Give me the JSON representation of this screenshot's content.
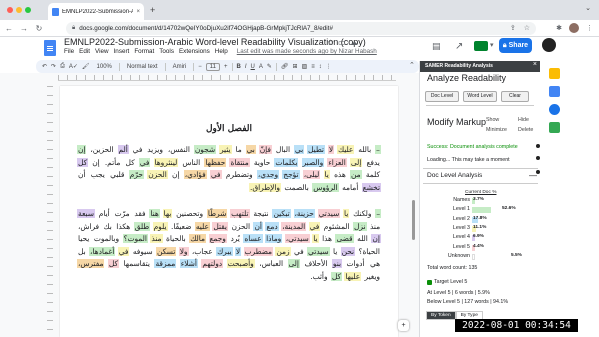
{
  "browser": {
    "tab_title": "EMNLP2022-Submission-Arabi",
    "url": "docs.google.com/document/d/14702wQeIY0oDjuXu2if74OGHjapB-GrMpkjTJcRlA7_8/edit#",
    "tab_close": "×",
    "new_tab": "+",
    "menu": "⌄"
  },
  "doc": {
    "title": "EMNLP2022-Submission-Arabic Word-level Readability Visualization (copy)",
    "menu": [
      "File",
      "Edit",
      "View",
      "Insert",
      "Format",
      "Tools",
      "Extensions",
      "Help"
    ],
    "last_edit": "Last edit was made seconds ago by Nizar Habash",
    "share": "Share"
  },
  "toolbar": {
    "zoom": "100%",
    "style": "Normal text",
    "font": "Amiri",
    "size": "11",
    "plus": "+",
    "minus": "−"
  },
  "page": {
    "chapter": "الفصل الأول",
    "p1": [
      {
        "t": "– بالله عليك لا تطيل بي البال فإنّ بي ما يثير شجون النفس، ويزيد في ألم الحزين، إن يدفع إلى العزاء والصبر بكلمات حاوية منتقاة حفظها الناس لينثروها في كل مأتم. إن كل كلمة من هذه يا ليلى، تؤجج وجدي، وتضطرم في فؤادي، إن الحزن حرّم قلبي يجب أن تخشع أمامه الرؤوس بالصمت والإطراق.",
        "c": ""
      }
    ],
    "p2": [
      {
        "t": "– ولكنك يا سيدتي حزينة، تبكين نتيجة تلتهب شرطًا وتحصنين بها هنا فقد مرّت أيام سبعة منذ نزل المشئوم في المدينة، دمع أن الحزن يقتل عليه ضعيفًا. يلوم طلق هكذا بك فراش، إن الله قضى هذا يا سيدتي، وماذا عساه يُرد وجمع مالك بالحياة منذ الموت؟ وبالموت يحيا الحياة؟ نحن يا سيدتي في زمن مضطرب لا يبرك عجاب، ولا تسكن سيوفه في أغمادها، بل هي أدوات بنو الأحلاف إلى العباس، وأصبحت دولتهم أشلاء ممزقة يتقاسمها كل مفترس، ويغير عليها كل وأثب.",
        "c": ""
      }
    ]
  },
  "panel": {
    "title": "SAMER Readability Analysis",
    "close": "×",
    "h1": "Analyze Readability",
    "btn_doc": "Doc Level",
    "btn_word": "Word Level",
    "btn_clear": "Clear",
    "h2": "Modify Markup",
    "show": "Show",
    "hide": "Hide",
    "minimize": "Minimize",
    "delete": "Delete",
    "success": "Success: Document analysis complete",
    "loading": "Loading... This may take a moment",
    "h3": "Doc Level Analysis",
    "minus": "—",
    "current_doc": "Current Doc %",
    "levels": [
      {
        "name": "Names",
        "v": "3.7%",
        "color": "#c6ecc6",
        "pct": 3.7
      },
      {
        "name": "Level 1",
        "v": "",
        "v2": "52.6%",
        "color": "#c6ecc6",
        "pct": 52.6
      },
      {
        "name": "Level 2",
        "v": "17.8%",
        "color": "#b9e0f7",
        "pct": 17.8
      },
      {
        "name": "Level 3",
        "v": "11.1%",
        "color": "#f8f3b5",
        "pct": 11.1
      },
      {
        "name": "Level 4",
        "v": "6.9%",
        "color": "#d8c9ef",
        "pct": 6.9
      },
      {
        "name": "Level 5",
        "v": "4.4%",
        "color": "#f8cfd3",
        "pct": 4.4
      },
      {
        "name": "Unknown",
        "v": "",
        "sub": "5.5%",
        "color": "#ffffff",
        "pct": 5.5
      }
    ],
    "total": "Total word count: 135",
    "target": "Target Level 5",
    "at_level": "At Level 5 | 6 words | 5.9%",
    "below": "Below Level 5 | 127 words | 94.1%",
    "tab_token": "By Token",
    "tab_type": "By Type"
  },
  "timestamp": "2022-08-01 00:34:54"
}
